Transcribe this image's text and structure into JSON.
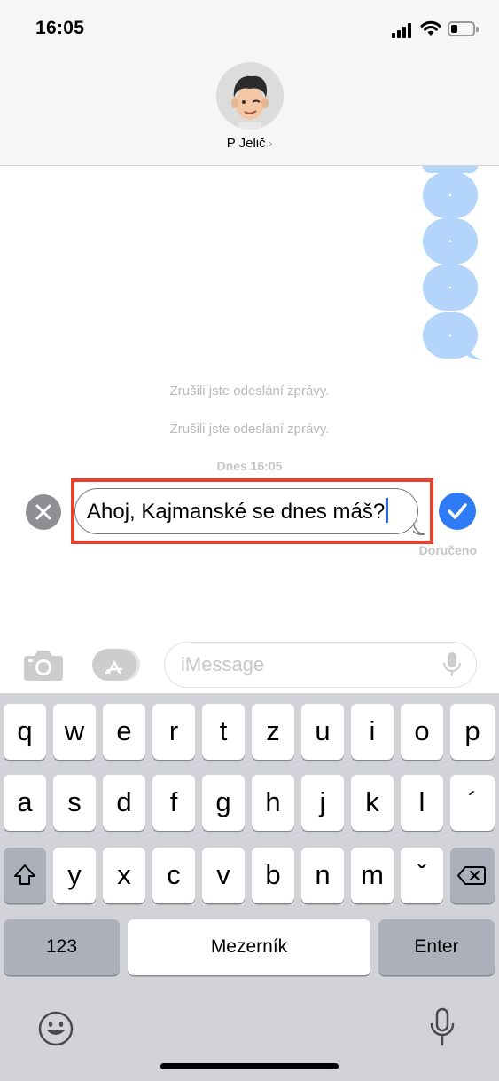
{
  "status_bar": {
    "time": "16:05"
  },
  "header": {
    "contact_name": "P Jelič",
    "chevron": "›"
  },
  "thread": {
    "sent_dot_bubbles": [
      ".",
      ".",
      ".",
      "."
    ],
    "system_notes": [
      "Zrušili jste odeslání zprávy.",
      "Zrušili jste odeslání zprávy."
    ],
    "timestamp": "Dnes 16:05",
    "editing_message": "Ahoj, Kajmanské se dnes máš?",
    "delivered_label": "Doručeno",
    "colors": {
      "sent_bubble": "#b3d4fb",
      "confirm": "#2f7bf5",
      "highlight": "#e8412f"
    }
  },
  "compose": {
    "placeholder": "iMessage"
  },
  "keyboard": {
    "row1": [
      "q",
      "w",
      "e",
      "r",
      "t",
      "z",
      "u",
      "i",
      "o",
      "p"
    ],
    "row2": [
      "a",
      "s",
      "d",
      "f",
      "g",
      "h",
      "j",
      "k",
      "l",
      "´"
    ],
    "row3": [
      "y",
      "x",
      "c",
      "v",
      "b",
      "n",
      "m",
      "ˇ"
    ],
    "numbers_label": "123",
    "space_label": "Mezerník",
    "enter_label": "Enter",
    "icons": {
      "shift": "shift-icon",
      "delete": "delete-icon",
      "emoji": "emoji-icon",
      "dictation": "microphone-icon"
    }
  }
}
